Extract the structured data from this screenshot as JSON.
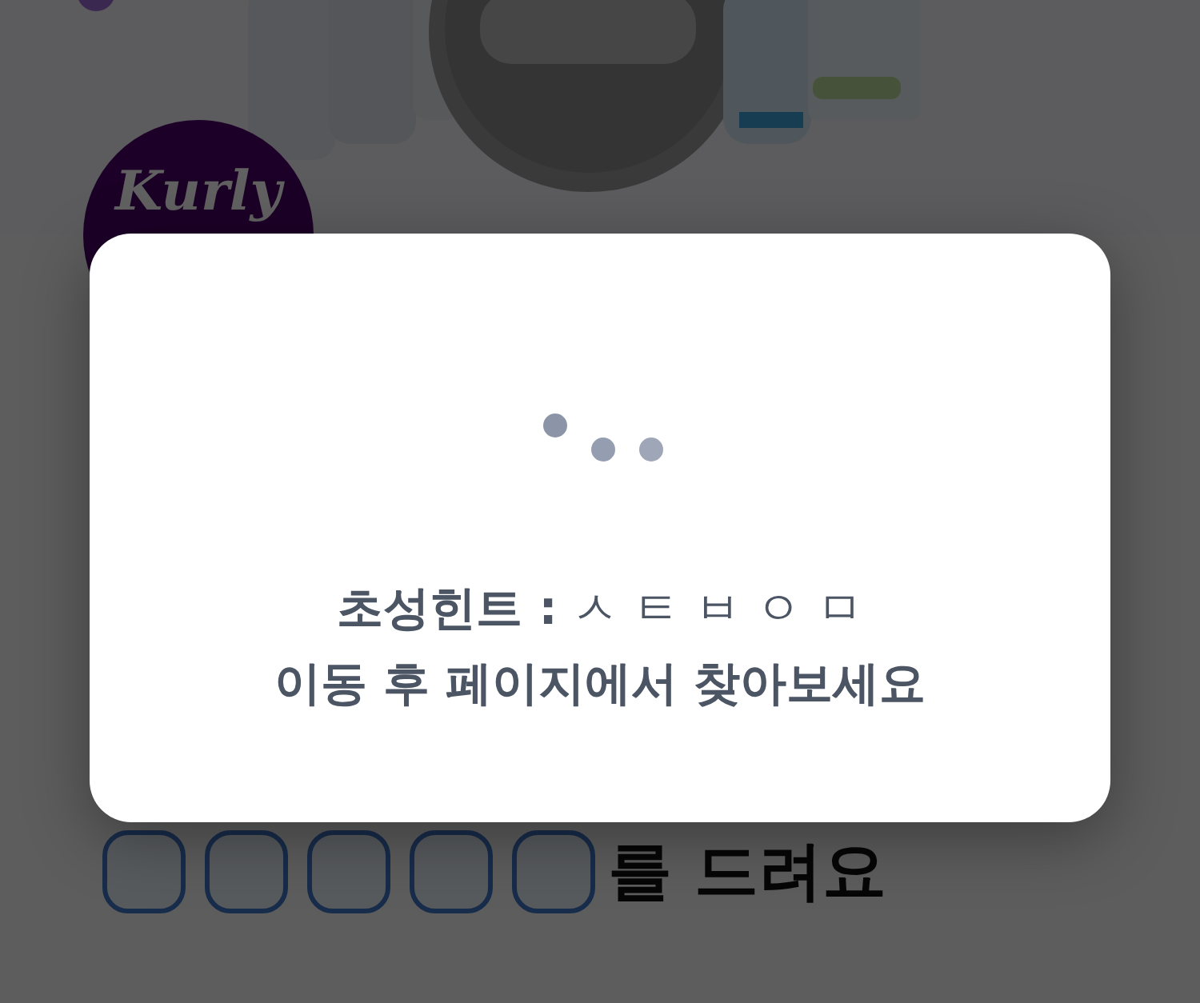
{
  "logo": {
    "text": "Kurly"
  },
  "answer": {
    "boxes": [
      {
        "kind": "blank"
      },
      {
        "kind": "blank"
      },
      {
        "kind": "blank"
      },
      {
        "kind": "blank"
      },
      {
        "kind": "blank"
      }
    ],
    "suffix": "를 드려요"
  },
  "modal": {
    "hint": "**초성힌트 :** ㅅ ㅌ ㅂ ㅇ ㅁ",
    "message": "이동 후 페이지에서 찾아보세요"
  }
}
